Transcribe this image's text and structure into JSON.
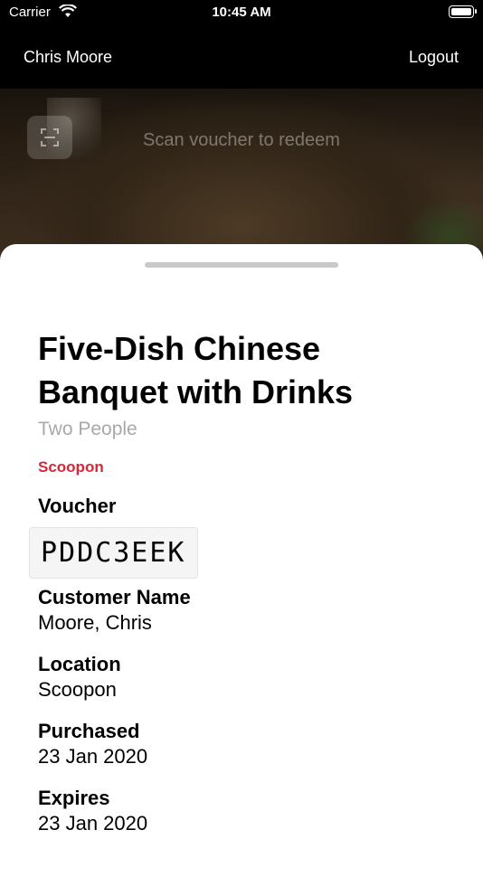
{
  "status_bar": {
    "carrier": "Carrier",
    "time": "10:45 AM"
  },
  "nav": {
    "user_name": "Chris Moore",
    "logout_label": "Logout"
  },
  "scanner": {
    "hint": "Scan voucher to redeem",
    "qr_icon": "qr-code-icon"
  },
  "deal": {
    "title": "Five-Dish Chinese Banquet with Drinks",
    "subtitle": "Two People",
    "merchant": "Scoopon"
  },
  "details": {
    "voucher_label": "Voucher",
    "voucher_code": "PDDC3EEK",
    "customer_label": "Customer Name",
    "customer_value": "Moore, Chris",
    "location_label": "Location",
    "location_value": "Scoopon",
    "purchased_label": "Purchased",
    "purchased_value": "23 Jan 2020",
    "expires_label": "Expires",
    "expires_value": "23 Jan 2020"
  },
  "colors": {
    "accent": "#d6283a",
    "nav_bg": "#000000",
    "sheet_bg": "#ffffff"
  }
}
